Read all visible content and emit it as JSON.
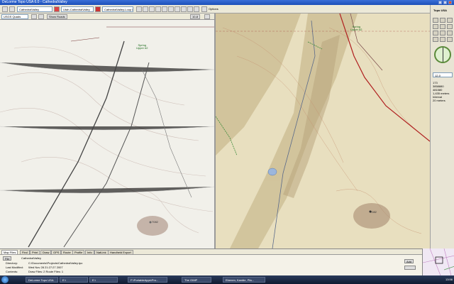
{
  "window": {
    "title": "DeLorme Topo USA 6.0 - CathedralValley"
  },
  "toolbar": {
    "map_file": "CathedralValley",
    "route": "Utah-CathedralValley",
    "route2": "CathedralValley-Loop 8/4",
    "options_label": "Options"
  },
  "mapbar": {
    "quad_select": "USGS Quads (DRG)",
    "show_roads": "Show Roads",
    "scale": "10-8"
  },
  "right_panel": {
    "brand": "Topo USA",
    "zoom_field": "12-0",
    "readout_1": "173",
    "readout_2": "3858880",
    "readout_3": "481580",
    "readout_4": "1,435 meters",
    "readout_5": "Interval",
    "readout_6": "20 meters"
  },
  "map_labels": {
    "left_spring": "Spring",
    "left_spring_sub": "Upper #2",
    "right_spring": "Spring",
    "right_spring_sub": "Upper #2",
    "left_peak": "7082",
    "right_peak": "7082"
  },
  "tabs": [
    {
      "label": "Map Files"
    },
    {
      "label": "Find"
    },
    {
      "label": "Print"
    },
    {
      "label": "Draw"
    },
    {
      "label": "GPS"
    },
    {
      "label": "Route"
    },
    {
      "label": "Profile"
    },
    {
      "label": "Info"
    },
    {
      "label": "NatLink"
    },
    {
      "label": "Handheld Export"
    }
  ],
  "bottom": {
    "file_label": "File",
    "file_name": "CathedralValley",
    "directory_label": "Directory:",
    "directory_value": "C:\\Documents\\Projects\\CathedralValley.tpo",
    "modified_label": "Last Modified:",
    "modified_value": "Wed Nov 28 21:27:27 2007",
    "contents_label": "Contents:",
    "contents_value": "Draw Files: 2  Route Files: 1",
    "add_button": "Add"
  },
  "taskbar": {
    "items": [
      {
        "label": "DeLorme Topo USA"
      },
      {
        "label": "E:\\"
      },
      {
        "label": "E:\\"
      },
      {
        "label": "F:\\PortableApps\\Pro..."
      },
      {
        "label": "The GIMP"
      },
      {
        "label": "Ebenen, Kanäle, Pfa..."
      }
    ],
    "clock": "13:56"
  }
}
